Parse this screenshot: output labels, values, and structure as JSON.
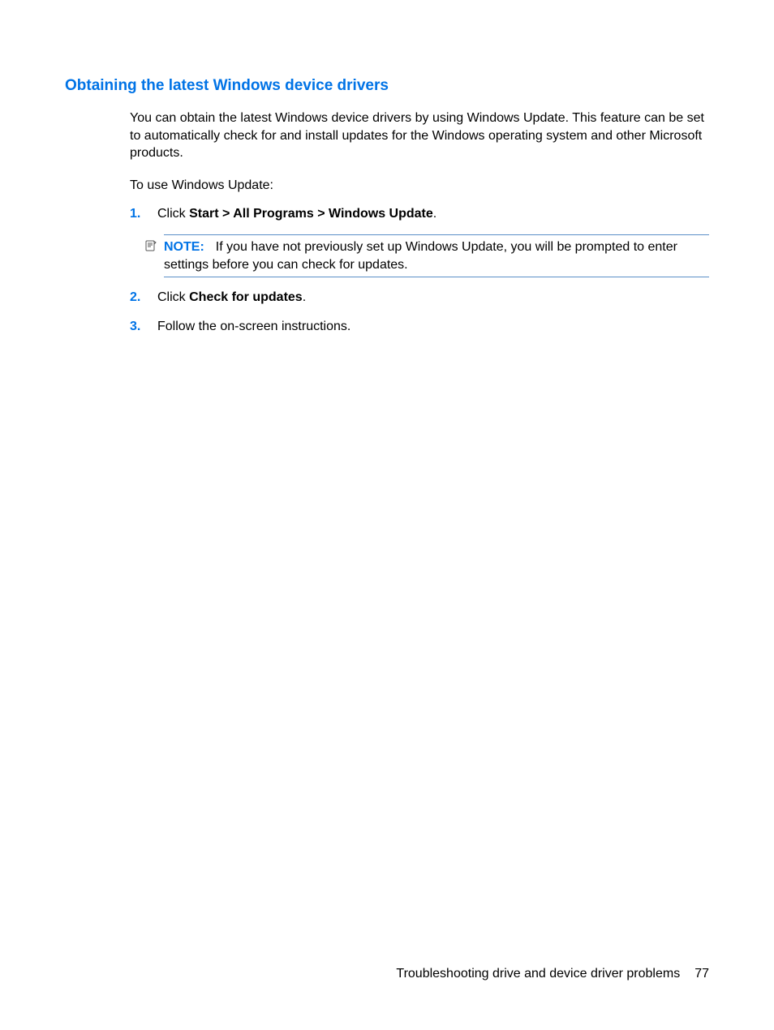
{
  "heading": "Obtaining the latest Windows device drivers",
  "intro": "You can obtain the latest Windows device drivers by using Windows Update. This feature can be set to automatically check for and install updates for the Windows operating system and other Microsoft products.",
  "lead": "To use Windows Update:",
  "steps": [
    {
      "num": "1.",
      "prefix": "Click ",
      "bold": "Start > All Programs > Windows Update",
      "suffix": "."
    },
    {
      "num": "2.",
      "prefix": "Click ",
      "bold": "Check for updates",
      "suffix": "."
    },
    {
      "num": "3.",
      "prefix": "Follow the on-screen instructions.",
      "bold": "",
      "suffix": ""
    }
  ],
  "note": {
    "label": "NOTE:",
    "text": "If you have not previously set up Windows Update, you will be prompted to enter settings before you can check for updates."
  },
  "footer": {
    "section": "Troubleshooting drive and device driver problems",
    "page": "77"
  }
}
